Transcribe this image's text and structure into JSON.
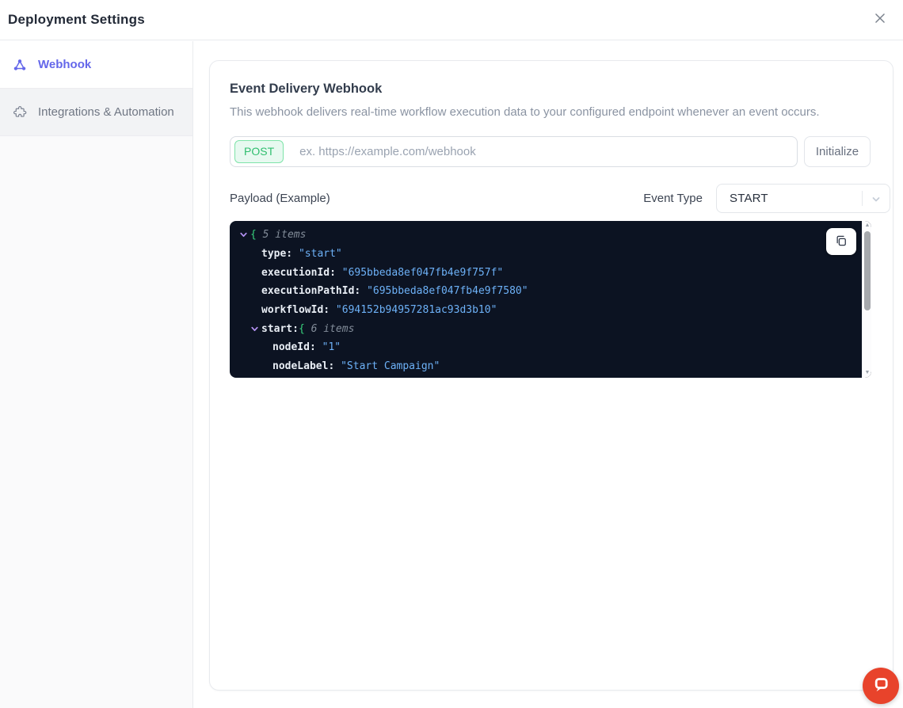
{
  "header": {
    "title": "Deployment Settings"
  },
  "sidebar": {
    "items": [
      {
        "label": "Webhook",
        "icon": "webhook-icon",
        "active": true
      },
      {
        "label": "Integrations & Automation",
        "icon": "puzzle-icon",
        "active": false
      }
    ]
  },
  "webhook_section": {
    "title": "Event Delivery Webhook",
    "description": "This webhook delivers real-time workflow execution data to your configured endpoint whenever an event occurs.",
    "method": "POST",
    "url_placeholder": "ex. https://example.com/webhook",
    "initialize_label": "Initialize",
    "payload_label": "Payload (Example)",
    "event_type_label": "Event Type",
    "event_type_value": "START"
  },
  "payload_viewer": {
    "lines": [
      {
        "depth": 0,
        "chevron": true,
        "tokens": [
          {
            "t": "brace",
            "v": "{ "
          },
          {
            "t": "meta",
            "v": "5 items"
          }
        ]
      },
      {
        "depth": 1,
        "chevron": false,
        "tokens": [
          {
            "t": "key",
            "v": "type: "
          },
          {
            "t": "str",
            "v": "\"start\""
          }
        ]
      },
      {
        "depth": 1,
        "chevron": false,
        "tokens": [
          {
            "t": "key",
            "v": "executionId: "
          },
          {
            "t": "str",
            "v": "\"695bbeda8ef047fb4e9f757f\""
          }
        ]
      },
      {
        "depth": 1,
        "chevron": false,
        "tokens": [
          {
            "t": "key",
            "v": "executionPathId: "
          },
          {
            "t": "str",
            "v": "\"695bbeda8ef047fb4e9f7580\""
          }
        ]
      },
      {
        "depth": 1,
        "chevron": false,
        "tokens": [
          {
            "t": "key",
            "v": "workflowId: "
          },
          {
            "t": "str",
            "v": "\"694152b94957281ac93d3b10\""
          }
        ]
      },
      {
        "depth": 1,
        "chevron": true,
        "tokens": [
          {
            "t": "key",
            "v": "start:"
          },
          {
            "t": "brace",
            "v": "{ "
          },
          {
            "t": "meta",
            "v": "6 items"
          }
        ]
      },
      {
        "depth": 2,
        "chevron": false,
        "tokens": [
          {
            "t": "key",
            "v": "nodeId: "
          },
          {
            "t": "str",
            "v": "\"1\""
          }
        ]
      },
      {
        "depth": 2,
        "chevron": false,
        "tokens": [
          {
            "t": "key",
            "v": "nodeLabel: "
          },
          {
            "t": "str",
            "v": "\"Start Campaign\""
          }
        ]
      }
    ]
  },
  "colors": {
    "accent_indigo": "#6467ea",
    "method_green": "#2fbe6e",
    "code_bg": "#0c1322",
    "code_key": "#e9eef5",
    "code_string": "#6db1f7",
    "code_brace": "#38d27d",
    "code_meta": "#828c99",
    "code_chevron": "#b592f3",
    "chat_red": "#e8432b"
  }
}
